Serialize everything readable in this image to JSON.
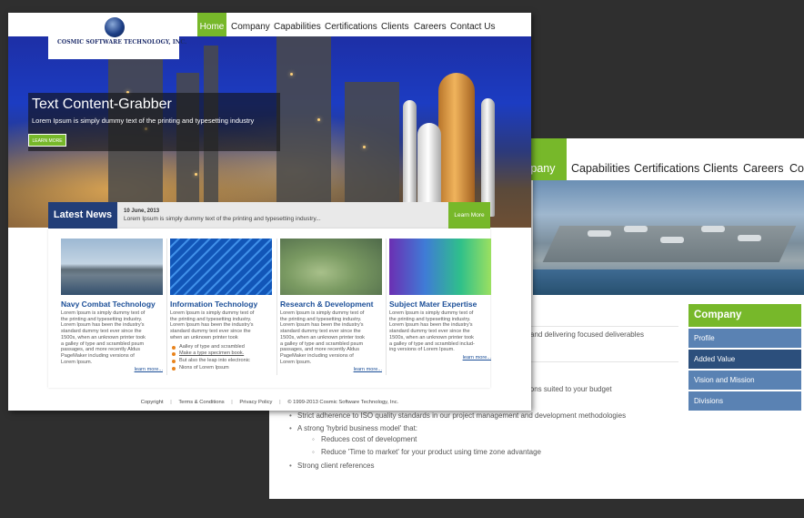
{
  "back_page": {
    "nav": [
      "ompany",
      "Capabilities",
      "Certifications",
      "Clients",
      "Careers",
      "Co"
    ],
    "lines": [
      "and delivering focused deliverables",
      "ions suited to your budget"
    ],
    "bullets": [
      "Strict adherence to ISO quality standards in our project management and development methodologies",
      "A strong 'hybrid business model' that:",
      "Strong client references"
    ],
    "sub_bullets": [
      "Reduces cost of development",
      "Reduce 'Time to market' for your product using time zone advantage"
    ],
    "sidebar": {
      "heading": "Company",
      "links": [
        "Profile",
        "Added Value",
        "Vision and Mission",
        "Divisions"
      ]
    }
  },
  "front_page": {
    "logo_text": "COSMIC SOFTWARE TECHNOLOGY, INC.",
    "nav": [
      "Home",
      "Company",
      "Capabilities",
      "Certifications",
      "Clients",
      "Careers",
      "Contact Us"
    ],
    "hero": {
      "title": "Text Content-Grabber",
      "subtitle": "Lorem Ipsum is simply dummy text of the printing and typesetting industry",
      "button": "LEARN MORE"
    },
    "news": {
      "label": "Latest News",
      "date": "10 June, 2013",
      "text": "Lorem Ipsum is simply dummy text of the printing and typesetting industry...",
      "button": "Learn More"
    },
    "columns": [
      {
        "title": "Navy Combat Technology",
        "desc": "Lorem Ipsum is simply dummy text of\nthe printing and typesetting industry.\nLorem Ipsum has been the industry's\nstandard dummy text ever since the\n1500s, when an unknown printer took\na galley of type and scrambled psum\npassages, and more recently Aldus\nPageMaker including versions of\nLorem Ipsum.",
        "more": "learn more..."
      },
      {
        "title": "Information Technology",
        "desc": "Lorem Ipsum is simply dummy text of\nthe printing and typesetting industry.\nLorem Ipsum has been the industry's\nstandard dummy text ever since the\nwhen an unknown printer took",
        "bullets": [
          "Aalley of type and scrambled",
          "Make a type specimen book.",
          "But also the leap into electronic",
          "Nions of Lorem Ipsum"
        ]
      },
      {
        "title": "Research & Development",
        "desc": "Lorem Ipsum is simply dummy text of\nthe printing and typesetting industry.\nLorem Ipsum has been the industry's\nstandard dummy text ever since the\n1500s, when an unknown printer took\na galley of type and scrambled psum\npassages, and more recently Aldus\nPageMaker including versions of\nLorem Ipsum.",
        "more": "learn more..."
      },
      {
        "title": "Subject Mater Expertise",
        "desc": "Lorem Ipsum is simply dummy text of\nthe printing and typesetting industry.\nLorem Ipsum has been the industry's\nstandard dummy text ever since the\n1500s, when an unknown printer took\na galley of type and scrambled includ-\ning versions of Lorem Ipsum.",
        "more": "learn more..."
      }
    ],
    "footer": {
      "copyright": "Copyright",
      "terms": "Terms & Conditions",
      "privacy": "Privacy Policy",
      "notice": "© 1999-2013 Cosmic Software Technology, Inc."
    }
  },
  "colors": {
    "accent": "#77b82a",
    "navy": "#223e78",
    "link_blue": "#1c4f98",
    "sidebar_blue": "#5a82b3"
  }
}
